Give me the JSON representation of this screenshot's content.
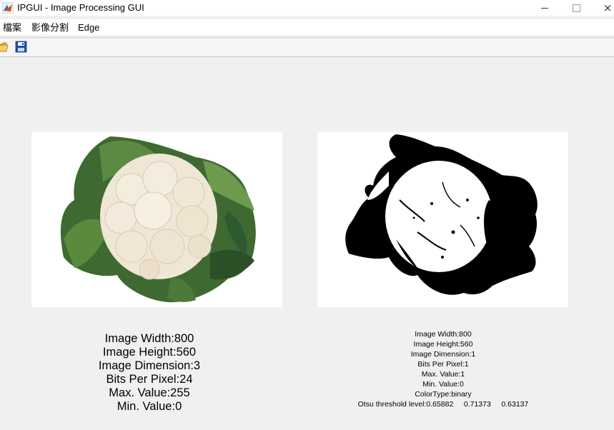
{
  "window": {
    "title": "IPGUI - Image Processing GUI",
    "minimize_glyph": "minimize-icon",
    "maximize_glyph": "maximize-icon",
    "close_glyph": "×"
  },
  "menu": {
    "items": [
      {
        "label": "檔案"
      },
      {
        "label": "影像分割"
      },
      {
        "label": "Edge"
      }
    ]
  },
  "toolbar": {
    "buttons": [
      {
        "icon": "open-folder-icon"
      },
      {
        "icon": "save-disk-icon"
      }
    ]
  },
  "original_info": {
    "lines": [
      "Image Width:800",
      "Image Height:560",
      "Image Dimension:3",
      "Bits Per Pixel:24",
      "Max. Value:255",
      "Min. Value:0"
    ]
  },
  "binary_info": {
    "lines": [
      "Image Width:800",
      "Image Height:560",
      "Image Dimension:1",
      "Bits Per Pixel:1",
      "Max. Value:1",
      "Min. Value:0",
      "ColorType:binary",
      "Otsu threshold level:0.65882     0.71373     0.63137"
    ]
  },
  "colors": {
    "leaf_dark": "#2f5a2a",
    "leaf_light": "#6f9a4e",
    "cauliflower": "#efe6d6",
    "background": "#f0f0f0"
  }
}
